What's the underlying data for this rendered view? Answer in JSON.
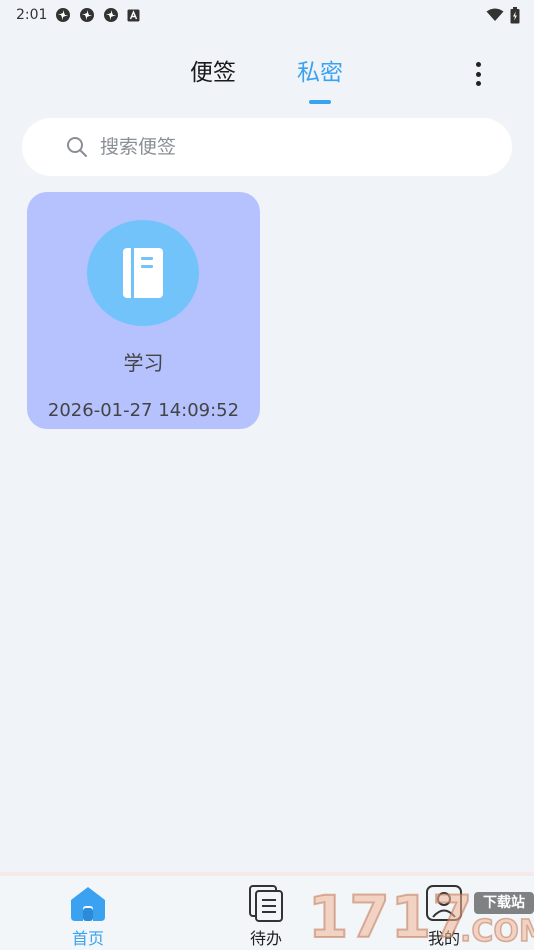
{
  "status_bar": {
    "time": "2:01",
    "notification_icons": [
      "pinwheel-icon",
      "pinwheel-icon",
      "pinwheel-icon",
      "a-box-icon"
    ],
    "right_icons": [
      "wifi-icon",
      "battery-icon"
    ]
  },
  "header": {
    "tabs": [
      {
        "label": "便签",
        "active": false
      },
      {
        "label": "私密",
        "active": true
      }
    ],
    "accent_color": "#3aa2f0",
    "more_icon": "more-vertical-icon"
  },
  "search": {
    "placeholder": "搜索便签",
    "value": "",
    "icon": "search-icon"
  },
  "notes": [
    {
      "title": "学习",
      "date": "2026-01-27 14:09:52",
      "icon": "notebook-icon",
      "card_color": "#b5c2fe",
      "icon_bg_color": "#73c3fb"
    }
  ],
  "bottom_nav": {
    "items": [
      {
        "label": "首页",
        "icon": "home-icon",
        "active": true
      },
      {
        "label": "待办",
        "icon": "todo-list-icon",
        "active": false
      },
      {
        "label": "我的",
        "icon": "profile-icon",
        "active": false
      }
    ]
  },
  "watermark": {
    "digits": "1717",
    "badge": "下载站",
    "domain": ".COM"
  }
}
